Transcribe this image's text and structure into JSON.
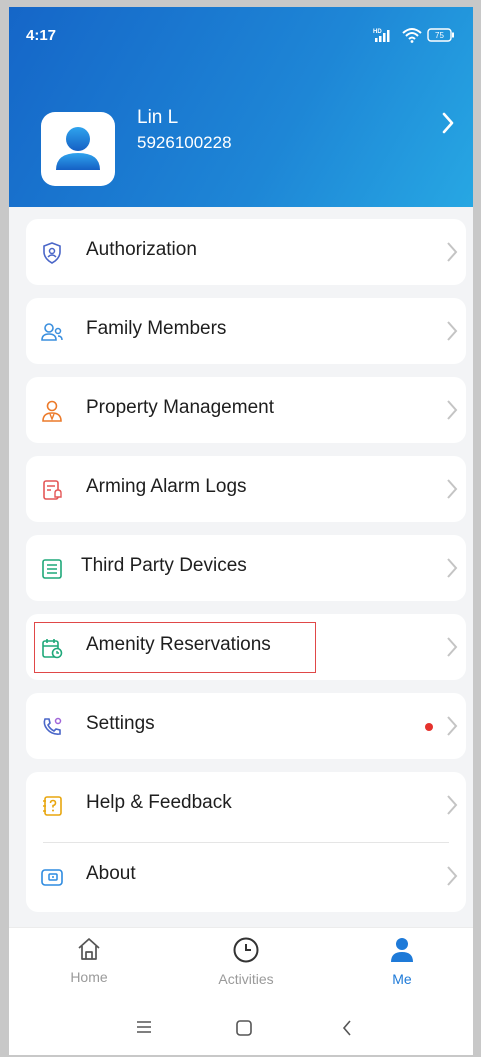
{
  "status_bar": {
    "time": "4:17",
    "network": "HD",
    "battery": "75"
  },
  "profile": {
    "name": "Lin L",
    "id": "5926100228"
  },
  "menu": {
    "authorization": "Authorization",
    "family_members": "Family Members",
    "property_management": "Property Management",
    "arming_alarm_logs": "Arming Alarm Logs",
    "third_party_devices": "Third Party Devices",
    "amenity_reservations": "Amenity Reservations",
    "settings": "Settings",
    "help_feedback": "Help & Feedback",
    "about": "About"
  },
  "tabs": {
    "home": "Home",
    "activities": "Activities",
    "me": "Me"
  },
  "colors": {
    "accent": "#1e7ad8",
    "header_start": "#1566c8",
    "header_end": "#27a7e3",
    "badge": "#e5322d",
    "highlight": "#e04848"
  }
}
